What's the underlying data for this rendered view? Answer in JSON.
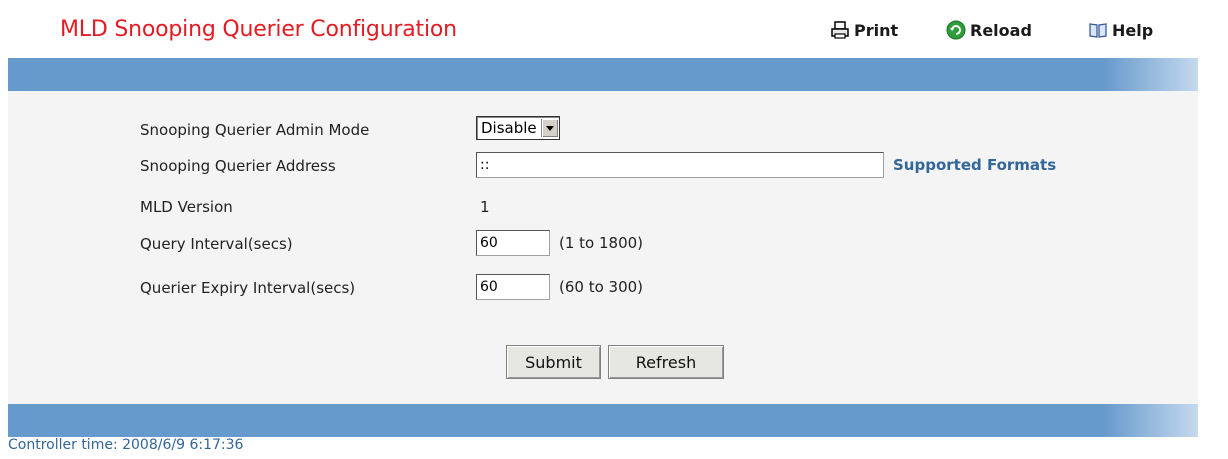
{
  "header": {
    "title": "MLD Snooping Querier Configuration",
    "print_label": "Print",
    "reload_label": "Reload",
    "help_label": "Help"
  },
  "form": {
    "admin_mode": {
      "label": "Snooping Querier Admin Mode",
      "value": "Disable"
    },
    "querier_address": {
      "label": "Snooping Querier Address",
      "value": "::",
      "link_label": "Supported Formats"
    },
    "mld_version": {
      "label": "MLD Version",
      "value": "1"
    },
    "query_interval": {
      "label": "Query Interval(secs)",
      "value": "60",
      "range": "(1 to 1800)"
    },
    "expiry_interval": {
      "label": "Querier Expiry Interval(secs)",
      "value": "60",
      "range": "(60 to 300)"
    }
  },
  "buttons": {
    "submit": "Submit",
    "refresh": "Refresh"
  },
  "footer": {
    "controller_time": "Controller time: 2008/6/9 6:17:36"
  },
  "colors": {
    "title": "#e31b23",
    "bar": "#6699cc",
    "link": "#336699"
  }
}
